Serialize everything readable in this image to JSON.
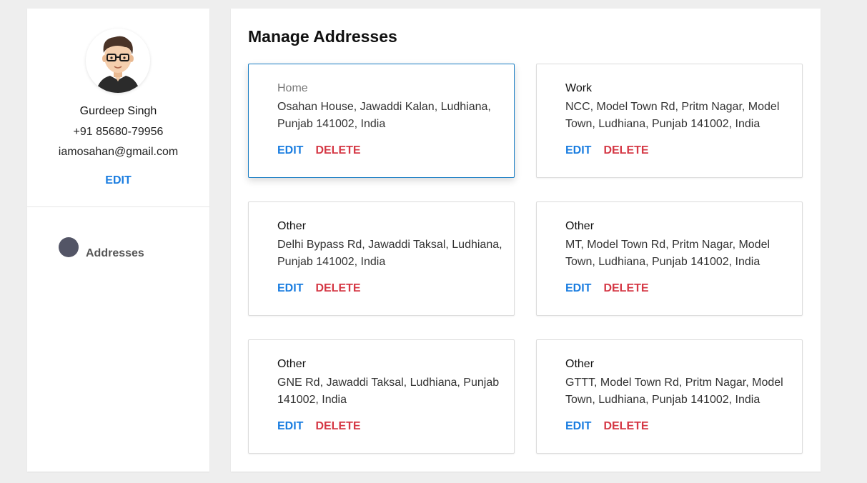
{
  "profile": {
    "name": "Gurdeep Singh",
    "phone": "+91 85680-79956",
    "email": "iamosahan@gmail.com",
    "edit_label": "EDIT",
    "avatar_icon": "user-avatar"
  },
  "nav": {
    "items": [
      {
        "label": "Addresses",
        "icon": "addresses-icon"
      }
    ]
  },
  "main": {
    "title": "Manage Addresses"
  },
  "addresses": [
    {
      "type": "Home",
      "address": "Osahan House, Jawaddi Kalan, Ludhiana, Punjab 141002, India",
      "edit": "EDIT",
      "delete": "DELETE"
    },
    {
      "type": "Work",
      "address": "NCC, Model Town Rd, Pritm Nagar, Model Town, Ludhiana, Punjab 141002, India",
      "edit": "EDIT",
      "delete": "DELETE"
    },
    {
      "type": "Other",
      "address": "Delhi Bypass Rd, Jawaddi Taksal, Ludhiana, Punjab 141002, India",
      "edit": "EDIT",
      "delete": "DELETE"
    },
    {
      "type": "Other",
      "address": "MT, Model Town Rd, Pritm Nagar, Model Town, Ludhiana, Punjab 141002, India",
      "edit": "EDIT",
      "delete": "DELETE"
    },
    {
      "type": "Other",
      "address": "GNE Rd, Jawaddi Taksal, Ludhiana, Punjab 141002, India",
      "edit": "EDIT",
      "delete": "DELETE"
    },
    {
      "type": "Other",
      "address": "GTTT, Model Town Rd, Pritm Nagar, Model Town, Ludhiana, Punjab 141002, India",
      "edit": "EDIT",
      "delete": "DELETE"
    }
  ],
  "colors": {
    "accent": "#1a7de0",
    "danger": "#d53845",
    "active_border": "#1a7ec4"
  }
}
